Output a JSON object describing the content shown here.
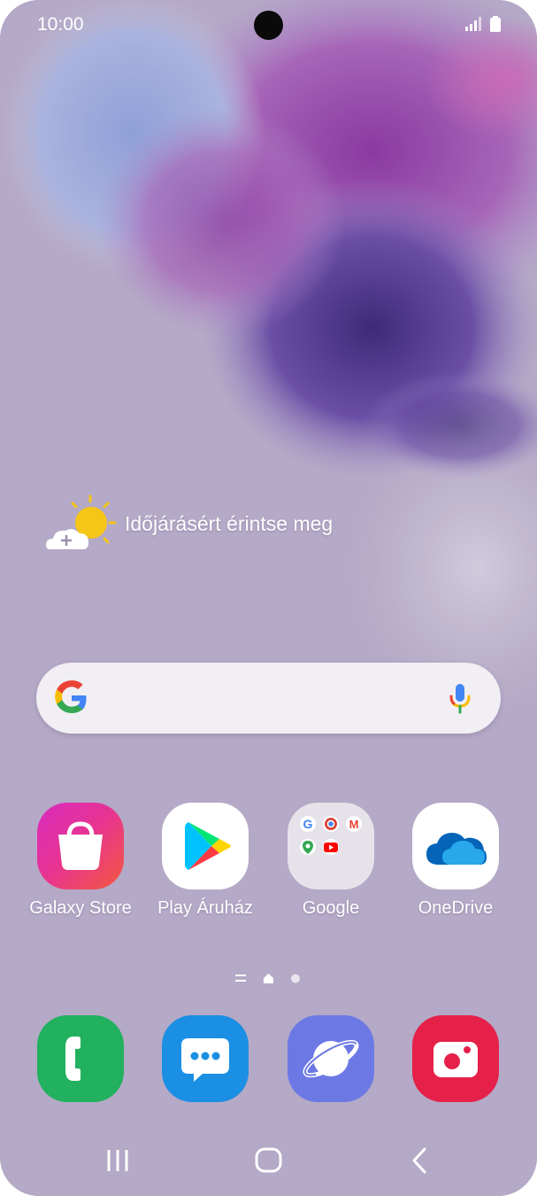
{
  "status_bar": {
    "time": "10:00",
    "icons": [
      "signal-icon",
      "battery-icon"
    ]
  },
  "weather_widget": {
    "text": "Időjárásért érintse meg",
    "icon": "sun-cloud-add-icon"
  },
  "search_bar": {
    "icons": [
      "google-g-icon",
      "microphone-icon"
    ]
  },
  "apps": [
    {
      "label": "Galaxy Store",
      "icon": "galaxy-store-icon"
    },
    {
      "label": "Play Áruház",
      "icon": "play-store-icon"
    },
    {
      "label": "Google",
      "icon": "google-folder-icon"
    },
    {
      "label": "OneDrive",
      "icon": "onedrive-icon"
    }
  ],
  "page_indicator": {
    "icons": [
      "menu-lines-icon",
      "home-page-icon",
      "page-dot-icon"
    ],
    "current_page": "home"
  },
  "dock": [
    {
      "icon": "phone-icon"
    },
    {
      "icon": "messages-icon"
    },
    {
      "icon": "internet-icon"
    },
    {
      "icon": "screen-recorder-icon"
    }
  ],
  "nav_bar": {
    "icons": [
      "recent-apps-icon",
      "home-icon",
      "back-icon"
    ]
  },
  "colors": {
    "background": "#b4a9c6",
    "text": "#ffffff",
    "search_bg": "#f1eff3"
  }
}
